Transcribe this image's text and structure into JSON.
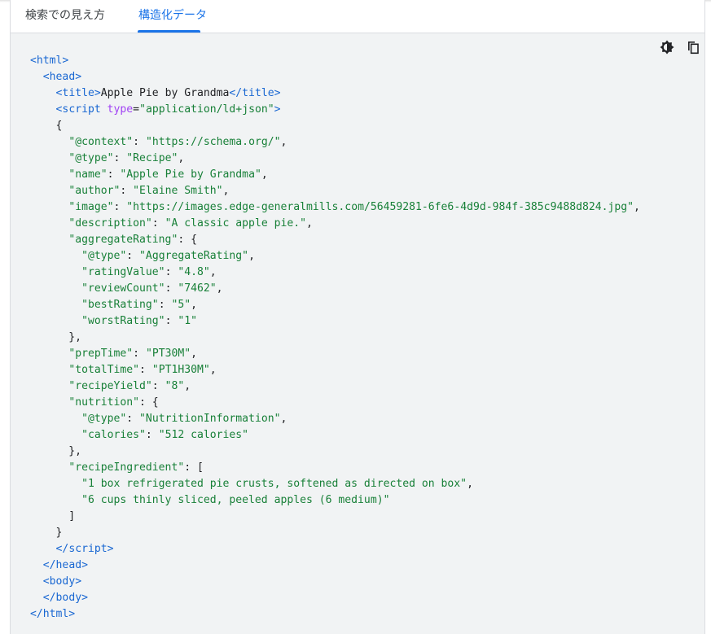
{
  "tabs": [
    {
      "label": "検索での見え方",
      "active": false
    },
    {
      "label": "構造化データ",
      "active": true
    }
  ],
  "toolbar": {
    "theme_icon": "theme-toggle-icon",
    "copy_icon": "copy-icon"
  },
  "colors": {
    "accent": "#1a73e8",
    "tag": "#1967d2",
    "attribute": "#a142f4",
    "string": "#188038",
    "code_background": "#f1f3f4"
  },
  "code": {
    "title_text": "Apple Pie by Grandma",
    "script_type": "\"application/ld+json\"",
    "context_key": "\"@context\"",
    "context_val": "\"https://schema.org/\"",
    "type_key": "\"@type\"",
    "type_val": "\"Recipe\"",
    "name_key": "\"name\"",
    "name_val": "\"Apple Pie by Grandma\"",
    "author_key": "\"author\"",
    "author_val": "\"Elaine Smith\"",
    "image_key": "\"image\"",
    "image_val": "\"https://images.edge-generalmills.com/56459281-6fe6-4d9d-984f-385c9488d824.jpg\"",
    "description_key": "\"description\"",
    "description_val": "\"A classic apple pie.\"",
    "aggregateRating_key": "\"aggregateRating\"",
    "ar_type_key": "\"@type\"",
    "ar_type_val": "\"AggregateRating\"",
    "ratingValue_key": "\"ratingValue\"",
    "ratingValue_val": "\"4.8\"",
    "reviewCount_key": "\"reviewCount\"",
    "reviewCount_val": "\"7462\"",
    "bestRating_key": "\"bestRating\"",
    "bestRating_val": "\"5\"",
    "worstRating_key": "\"worstRating\"",
    "worstRating_val": "\"1\"",
    "prepTime_key": "\"prepTime\"",
    "prepTime_val": "\"PT30M\"",
    "totalTime_key": "\"totalTime\"",
    "totalTime_val": "\"PT1H30M\"",
    "recipeYield_key": "\"recipeYield\"",
    "recipeYield_val": "\"8\"",
    "nutrition_key": "\"nutrition\"",
    "nu_type_key": "\"@type\"",
    "nu_type_val": "\"NutritionInformation\"",
    "calories_key": "\"calories\"",
    "calories_val": "\"512 calories\"",
    "recipeIngredient_key": "\"recipeIngredient\"",
    "ingredient_1": "\"1 box refrigerated pie crusts, softened as directed on box\"",
    "ingredient_2": "\"6 cups thinly sliced, peeled apples (6 medium)\""
  }
}
